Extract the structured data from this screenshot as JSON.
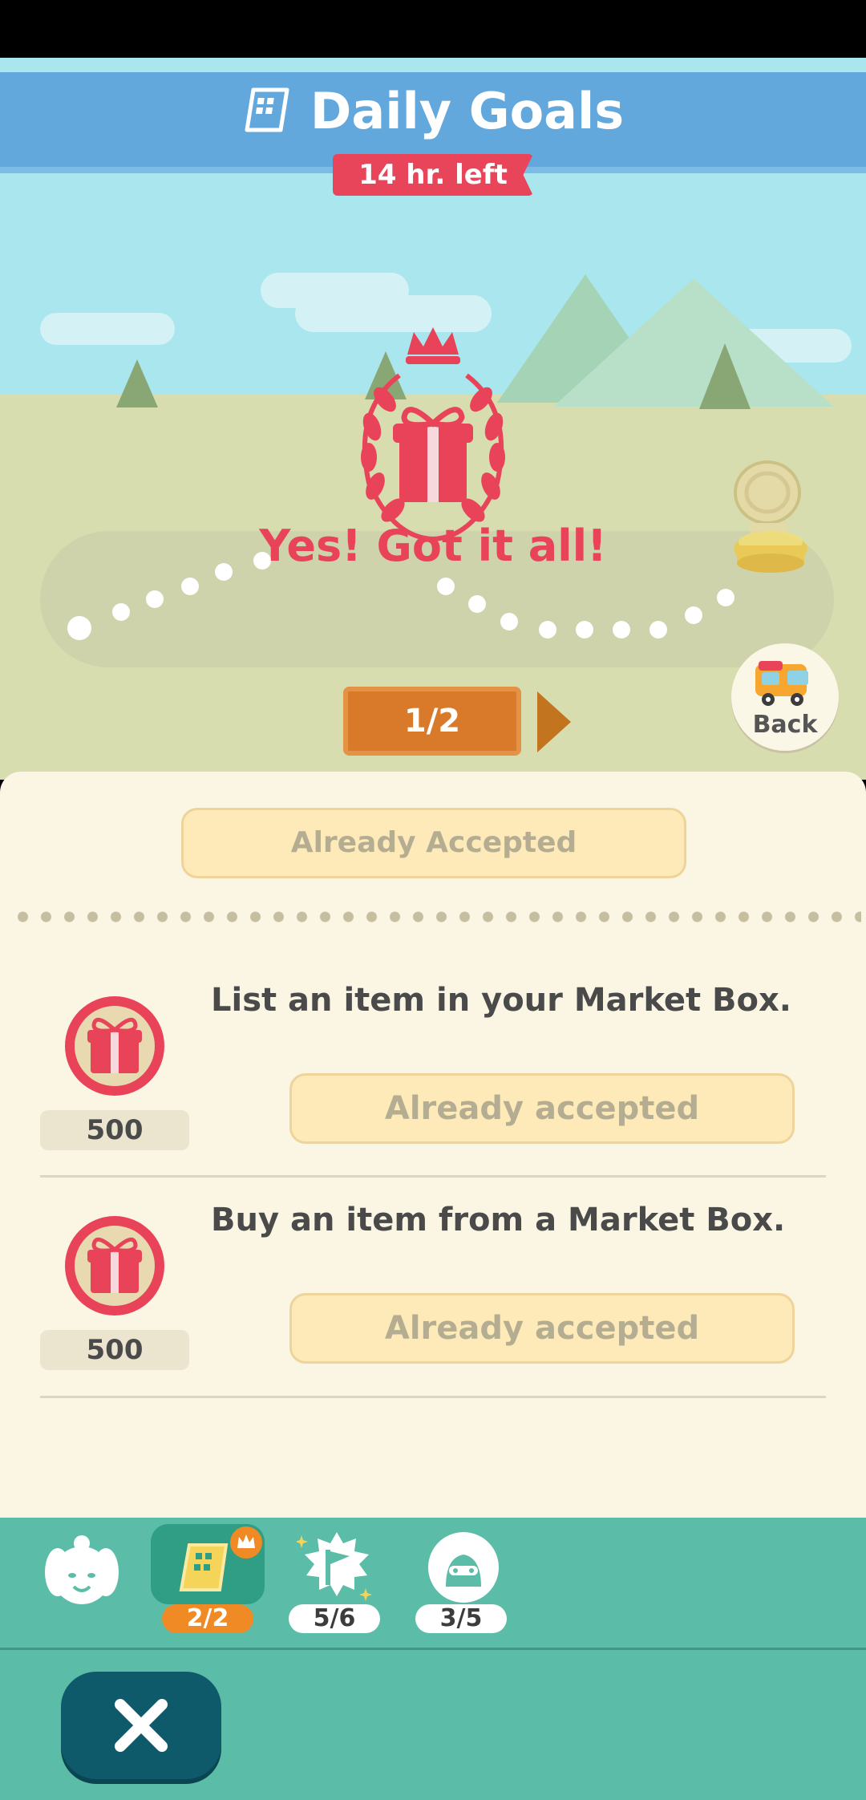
{
  "header": {
    "title": "Daily Goals",
    "time_left": "14 hr. left"
  },
  "scene": {
    "complete_message": "Yes! Got it all!",
    "page_indicator": "1/2",
    "back_label": "Back"
  },
  "panel": {
    "top_status": "Already Accepted",
    "goals": [
      {
        "text": "List an item in your Market Box.",
        "reward": "500",
        "status": "Already accepted"
      },
      {
        "text": "Buy an item from a Market Box.",
        "reward": "500",
        "status": "Already accepted"
      }
    ]
  },
  "tabs": [
    {
      "name": "isabelle",
      "counter": ""
    },
    {
      "name": "daily-goals",
      "counter": "2/2",
      "active": true
    },
    {
      "name": "special-goals",
      "counter": "5/6"
    },
    {
      "name": "timed-goals",
      "counter": "3/5"
    }
  ],
  "colors": {
    "title_band": "#62a8dc",
    "accent_red": "#e84359",
    "tab_bar": "#5bbca7",
    "close_button": "#0e5a6a"
  }
}
